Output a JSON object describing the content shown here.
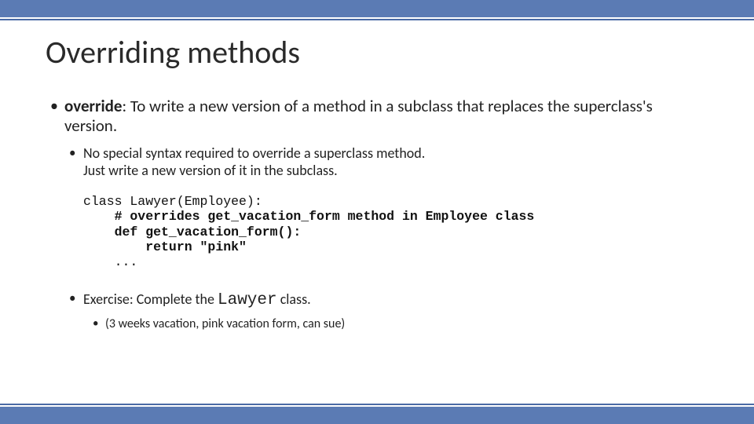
{
  "title": "Overriding methods",
  "bullets": {
    "b1_term": "override",
    "b1_rest": ": To write a new version of a method in a subclass that replaces the superclass's version.",
    "b2_line1": "No special syntax required to override a superclass method.",
    "b2_line2": "Just write a new version of it in the subclass.",
    "ex_prefix": "Exercise: Complete the ",
    "ex_code": "Lawyer",
    "ex_suffix": " class.",
    "b3": "(3 weeks vacation, pink vacation form, can sue)"
  },
  "code": {
    "l1": "class Lawyer(Employee):",
    "l2": "    # overrides get_vacation_form method in Employee class",
    "l3": "    def get_vacation_form():",
    "l4": "        return \"pink\"",
    "l5": "    ..."
  }
}
